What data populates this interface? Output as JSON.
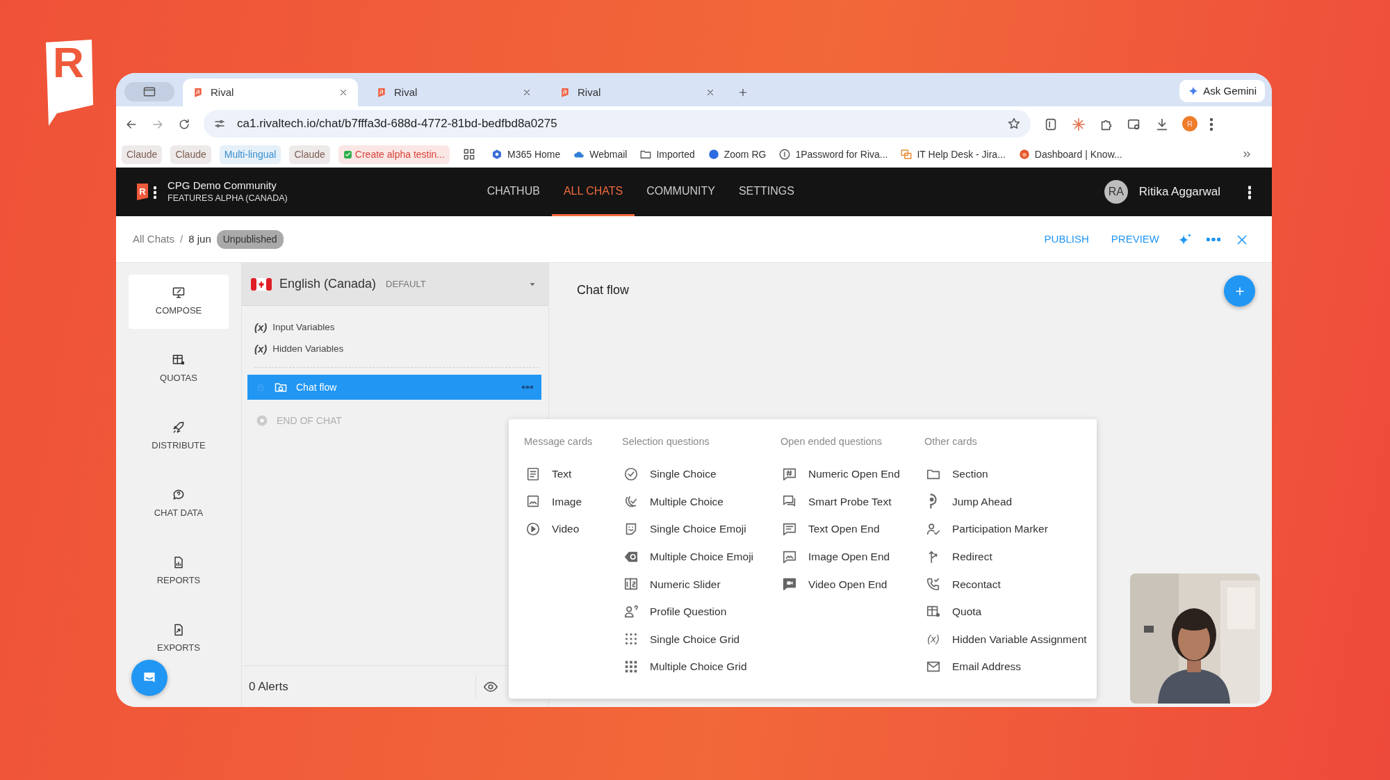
{
  "brand_mark": "R",
  "browser": {
    "tabs": [
      {
        "title": "Rival",
        "selected": true
      },
      {
        "title": "Rival",
        "selected": false
      },
      {
        "title": "Rival",
        "selected": false
      }
    ],
    "ask_gemini": "Ask Gemini",
    "url": "ca1.rivaltech.io/chat/b7fffa3d-688d-4772-81bd-bedfbd8a0275",
    "profile_initial": "R",
    "bookmarks": [
      {
        "kind": "chip",
        "label": "Claude",
        "color": "#7a5e52"
      },
      {
        "kind": "chip",
        "label": "Claude",
        "color": "#7a5e52"
      },
      {
        "kind": "chip",
        "label": "Multi-lingual",
        "color": "#3a8fd0"
      },
      {
        "kind": "chip",
        "label": "Claude",
        "color": "#7a5e52"
      },
      {
        "kind": "chip",
        "label": "Create alpha testin...",
        "color": "#d9433a"
      },
      {
        "kind": "link",
        "label": "M365 Home"
      },
      {
        "kind": "link",
        "label": "Webmail"
      },
      {
        "kind": "link",
        "label": "Imported"
      },
      {
        "kind": "link",
        "label": "Zoom RG"
      },
      {
        "kind": "link",
        "label": "1Password for Riva..."
      },
      {
        "kind": "link",
        "label": "IT Help Desk - Jira..."
      },
      {
        "kind": "link",
        "label": "Dashboard | Know..."
      }
    ]
  },
  "app": {
    "logo_letter": "R",
    "community": "CPG Demo Community",
    "subtitle": "FEATURES ALPHA (CANADA)",
    "nav": [
      {
        "label": "CHATHUB",
        "selected": false
      },
      {
        "label": "ALL CHATS",
        "selected": true
      },
      {
        "label": "COMMUNITY",
        "selected": false
      },
      {
        "label": "SETTINGS",
        "selected": false
      }
    ],
    "user": {
      "initials": "RA",
      "name": "Ritika Aggarwal"
    }
  },
  "breadcrumb": {
    "items": [
      "All Chats",
      "8 jun"
    ],
    "separator": "/",
    "status": "Unpublished"
  },
  "actions": [
    "PUBLISH",
    "PREVIEW"
  ],
  "sidebar": [
    {
      "label": "COMPOSE",
      "selected": true
    },
    {
      "label": "QUOTAS",
      "selected": false
    },
    {
      "label": "DISTRIBUTE",
      "selected": false
    },
    {
      "label": "CHAT DATA",
      "selected": false
    },
    {
      "label": "REPORTS",
      "selected": false
    },
    {
      "label": "EXPORTS",
      "selected": false
    }
  ],
  "language": {
    "name": "English (Canada)",
    "tag": "DEFAULT"
  },
  "variables": [
    {
      "glyph": "(x)",
      "label": "Input Variables"
    },
    {
      "glyph": "(x)",
      "label": "Hidden Variables"
    }
  ],
  "flow": [
    {
      "label": "Chat flow",
      "selected": true,
      "disabled": false
    },
    {
      "label": "END OF CHAT",
      "selected": false,
      "disabled": true
    }
  ],
  "alerts": "0 Alerts",
  "main_title": "Chat flow",
  "card_menu": [
    {
      "heading": "Message cards",
      "items": [
        {
          "label": "Text"
        },
        {
          "label": "Image"
        },
        {
          "label": "Video"
        }
      ]
    },
    {
      "heading": "Selection questions",
      "items": [
        {
          "label": "Single Choice"
        },
        {
          "label": "Multiple Choice"
        },
        {
          "label": "Single Choice Emoji"
        },
        {
          "label": "Multiple Choice Emoji"
        },
        {
          "label": "Numeric Slider"
        },
        {
          "label": "Profile Question"
        },
        {
          "label": "Single Choice Grid"
        },
        {
          "label": "Multiple Choice Grid"
        }
      ]
    },
    {
      "heading": "Open ended questions",
      "items": [
        {
          "label": "Numeric Open End"
        },
        {
          "label": "Smart Probe Text"
        },
        {
          "label": "Text Open End"
        },
        {
          "label": "Image Open End"
        },
        {
          "label": "Video Open End"
        }
      ]
    },
    {
      "heading": "Other cards",
      "items": [
        {
          "label": "Section"
        },
        {
          "label": "Jump Ahead"
        },
        {
          "label": "Participation Marker"
        },
        {
          "label": "Redirect"
        },
        {
          "label": "Recontact"
        },
        {
          "label": "Quota"
        },
        {
          "label": "Hidden Variable Assignment",
          "glyph": "(x)"
        },
        {
          "label": "Email Address"
        }
      ]
    }
  ],
  "video": {
    "kind": "picture"
  }
}
